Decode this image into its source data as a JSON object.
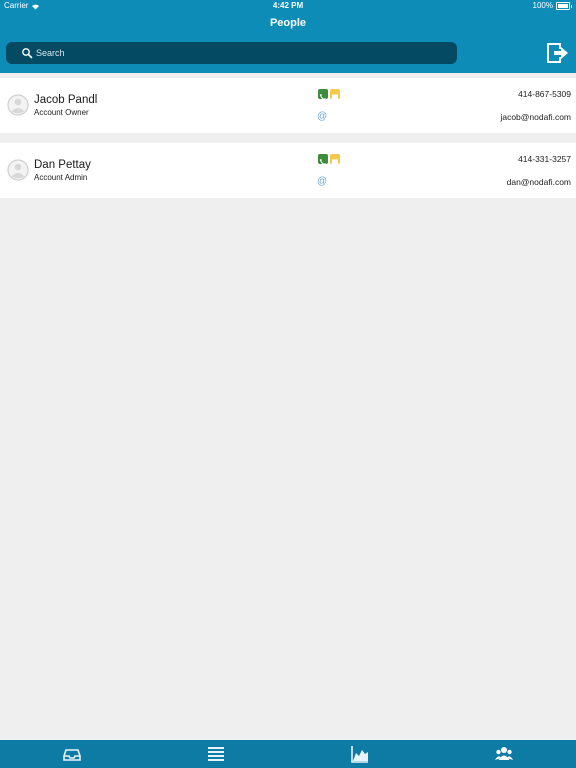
{
  "status": {
    "carrier": "Carrier",
    "time": "4:42 PM",
    "battery": "100%"
  },
  "header": {
    "title": "People"
  },
  "search": {
    "placeholder": "Search",
    "value": ""
  },
  "people": [
    {
      "name": "Jacob Pandl",
      "role": "Account Owner",
      "phone": "414-867-5309",
      "email": "jacob@nodafi.com"
    },
    {
      "name": "Dan Pettay",
      "role": "Account Admin",
      "phone": "414-331-3257",
      "email": "dan@nodafi.com"
    }
  ],
  "icons": {
    "logout": "logout-icon",
    "search": "search-icon",
    "tabs": [
      "inbox-icon",
      "list-icon",
      "chart-icon",
      "people-icon"
    ]
  },
  "colors": {
    "header": "#0e8cb8",
    "search": "#054a63",
    "tabbar": "#0e7ba4",
    "call": "#3f8c3f",
    "message": "#f2c94c",
    "email": "#6aa7d6"
  }
}
